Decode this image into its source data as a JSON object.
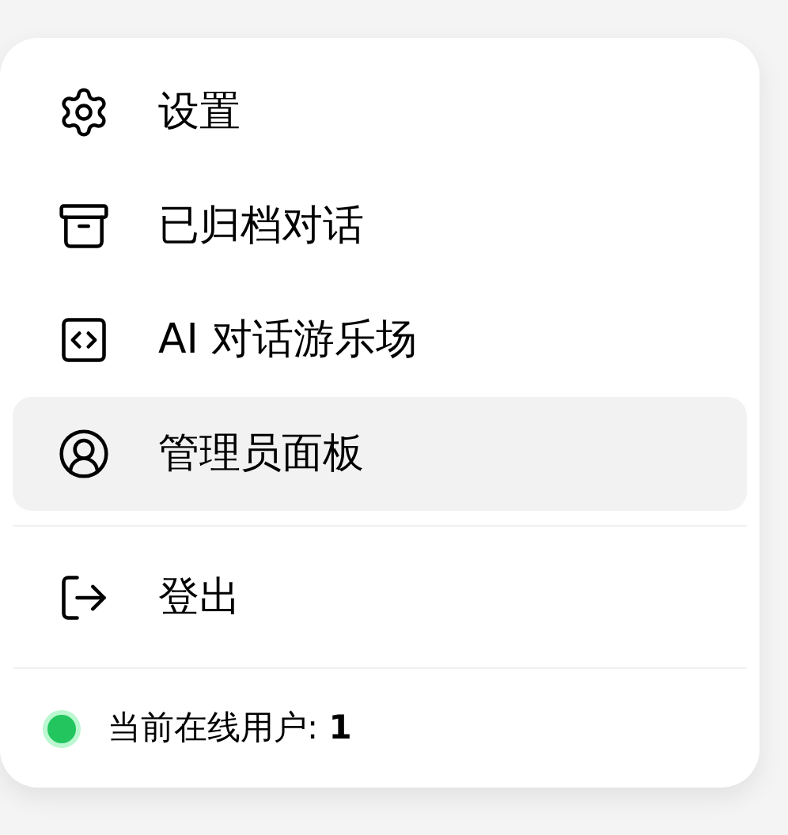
{
  "menu": {
    "items": [
      {
        "kind": "settings",
        "label": "设置",
        "selected": false
      },
      {
        "kind": "archive",
        "label": "已归档对话",
        "selected": false
      },
      {
        "kind": "code",
        "label": "AI 对话游乐场",
        "selected": false
      },
      {
        "kind": "user",
        "label": "管理员面板",
        "selected": true
      }
    ],
    "logout": {
      "kind": "logout",
      "label": "登出",
      "selected": false
    },
    "status": {
      "color": "#22c55e",
      "text": "当前在线用户: **1**"
    }
  }
}
